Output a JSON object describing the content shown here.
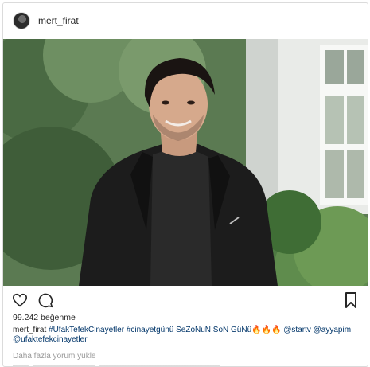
{
  "post": {
    "username": "mert_firat",
    "likes": "99.242 beğenme",
    "caption_user": "mert_firat",
    "caption_text": " #UfakTefekCinayetler #cinayetgünü SeZoNuN SoN GüNü🔥🔥🔥 @startv @ayyapim @ufaktefekcinayetler",
    "more_comments": "Daha fazla yorum yükle"
  },
  "icons": {
    "like": "heart-outline-icon",
    "comment": "comment-bubble-icon",
    "save": "bookmark-outline-icon"
  }
}
